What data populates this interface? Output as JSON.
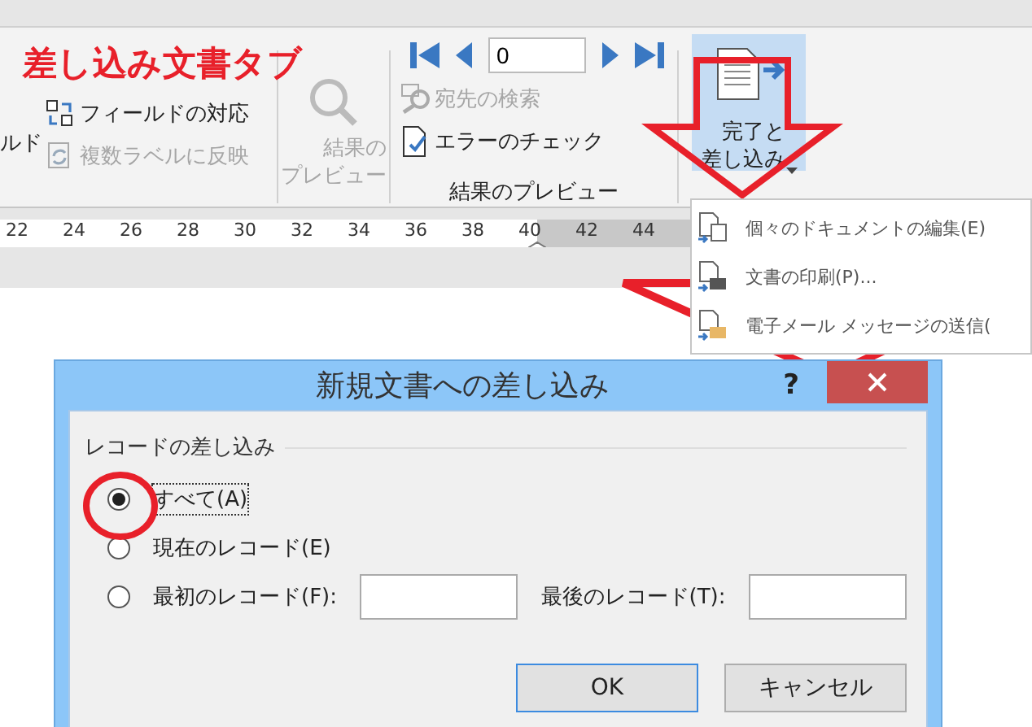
{
  "annotation": {
    "title": "差し込み文書タブ"
  },
  "ribbon": {
    "cut_label": "ルド",
    "field_items": [
      {
        "label": "フィールドの対応",
        "disabled": false
      },
      {
        "label": "複数ラベルに反映",
        "disabled": true
      }
    ],
    "preview_button": {
      "label": "結果のプレビュー",
      "disabled": true
    },
    "record": "0",
    "find_recipient": {
      "label": "宛先の検索",
      "disabled": true
    },
    "check_errors": {
      "label": "エラーのチェック",
      "disabled": false
    },
    "group_label": "結果のプレビュー",
    "finish_button": {
      "label": "完了と差し込み",
      "selected": true
    }
  },
  "ruler": {
    "marks": [
      "22",
      "24",
      "26",
      "28",
      "30",
      "32",
      "34",
      "36",
      "38",
      "40",
      "42",
      "44"
    ]
  },
  "menu": {
    "items": [
      {
        "label": "個々のドキュメントの編集(E)",
        "kind": "edit"
      },
      {
        "label": "文書の印刷(P)...",
        "kind": "print"
      },
      {
        "label": "電子メール メッセージの送信(",
        "kind": "email"
      }
    ]
  },
  "dialog": {
    "title": "新規文書への差し込み",
    "help": "?",
    "group_label": "レコードの差し込み",
    "options": [
      {
        "label": "すべて(A)",
        "selected": true,
        "kind": "plain"
      },
      {
        "label": "現在のレコード(E)",
        "selected": false,
        "kind": "plain"
      },
      {
        "label": "最初のレコード(F):",
        "selected": false,
        "kind": "range"
      }
    ],
    "to_label": "最後のレコード(T):",
    "buttons": [
      "OK",
      "キャンセル"
    ]
  }
}
